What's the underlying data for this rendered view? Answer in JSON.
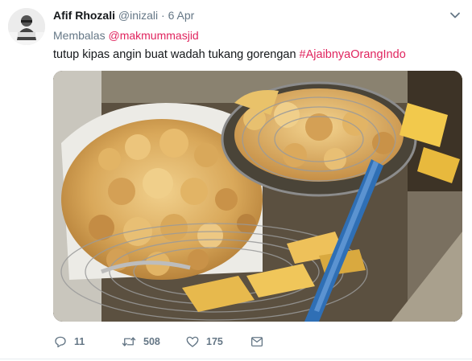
{
  "tweet": {
    "author_name": "Afif Rhozali",
    "handle": "@inizali",
    "separator": "·",
    "date": "6 Apr",
    "reply_prefix": "Membalas",
    "reply_mention": "@makmummasjid",
    "text": "tutup kipas angin buat wadah tukang gorengan",
    "hashtag": "#AjaibnyaOrangIndo"
  },
  "actions": {
    "reply_count": "11",
    "retweet_count": "508",
    "like_count": "175"
  },
  "icons": {
    "reply": "comment-bubble-icon",
    "retweet": "retweet-icon",
    "like": "heart-icon",
    "dm": "envelope-icon",
    "menu": "chevron-down-icon"
  },
  "colors": {
    "accent": "#e0245e",
    "secondary_text": "#657786",
    "primary_text": "#14171a"
  }
}
